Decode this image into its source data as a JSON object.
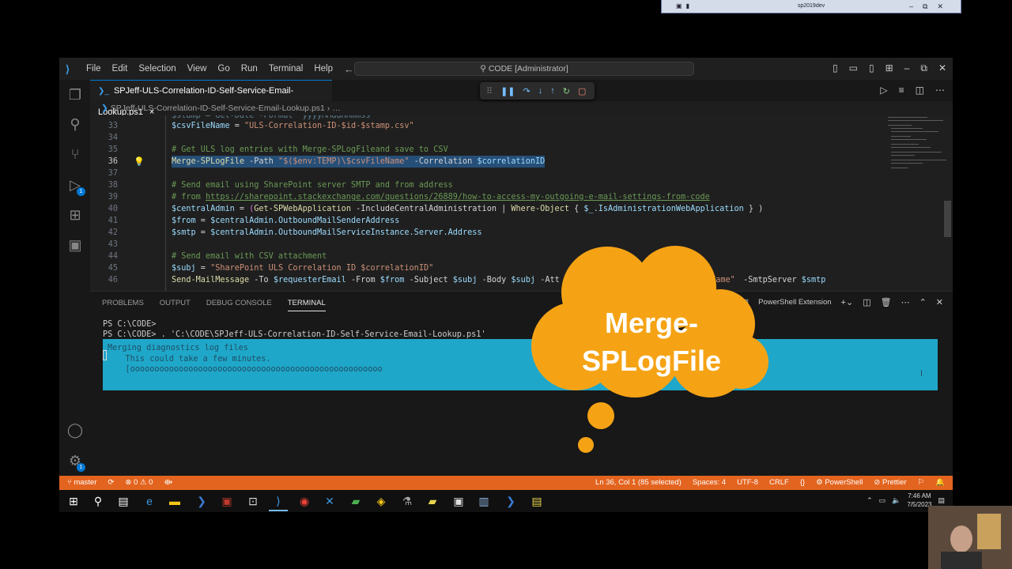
{
  "remote_bar": {
    "title": "sp2019dev"
  },
  "titlebar": {
    "menu": [
      "File",
      "Edit",
      "Selection",
      "View",
      "Go",
      "Run",
      "Terminal",
      "Help"
    ],
    "search": "CODE [Administrator]"
  },
  "tab": {
    "label": "SPJeff-ULS-Correlation-ID-Self-Service-Email-Lookup.ps1",
    "close": "×"
  },
  "breadcrumb": {
    "file": "SPJeff-ULS-Correlation-ID-Self-Service-Email-Lookup.ps1",
    "more": "…"
  },
  "editor": {
    "line_numbers": [
      "33",
      "34",
      "35",
      "36",
      "37",
      "38",
      "39",
      "40",
      "41",
      "42",
      "43",
      "44",
      "45",
      "46"
    ],
    "active_line": "36",
    "lines": {
      "l33_var": "$csvFileName",
      "l33_op": " = ",
      "l33_str": "\"ULS-Correlation-ID-$id-$stamp.csv\"",
      "l35": "# Get ULS log entries with Merge-SPLogFileand save to CSV",
      "l36_fn": "Merge-SPLogFile",
      "l36_p1": " -Path ",
      "l36_str": "\"$($env:TEMP)\\$csvFileName\"",
      "l36_p2": " -Correlation ",
      "l36_var": "$correlationID",
      "l38": "# Send email using SharePoint server SMTP and from address",
      "l39_a": "# from ",
      "l39_link": "https://sharepoint.stackexchange.com/questions/26889/how-to-access-my-outgoing-e-mail-settings-from-code",
      "l40_var": "$centralAdmin",
      "l40_op": " = ",
      "l40_rest_a": "(",
      "l40_fn": "Get-SPWebApplication",
      "l40_rest_b": " -IncludeCentralAdministration | ",
      "l40_fn2": "Where-Object",
      "l40_rest_c": " { ",
      "l40_var2": "$_.IsAdministrationWebApplication",
      "l40_rest_d": " } )",
      "l41_var": "$from",
      "l41_op": " = ",
      "l41_rest": "$centralAdmin.OutboundMailSenderAddress",
      "l42_var": "$smtp",
      "l42_op": " = ",
      "l42_rest": "$centralAdmin.OutboundMailServiceInstance.Server.Address",
      "l44": "# Send email with CSV attachment",
      "l45_var": "$subj",
      "l45_op": " = ",
      "l45_str": "\"SharePoint ULS Correlation ID $correlationID\"",
      "l46_fn": "Send-MailMessage",
      "l46_a": " -To ",
      "l46_v1": "$requesterEmail",
      "l46_b": " -From ",
      "l46_v2": "$from",
      "l46_c": " -Subject ",
      "l46_v3": "$subj",
      "l46_d": " -Body ",
      "l46_v4": "$subj",
      "l46_e": " -Att",
      "l46_str2": "$csvFileName\"",
      "l46_f": " -SmtpServer ",
      "l46_v5": "$smtp"
    }
  },
  "panel": {
    "tabs": [
      "PROBLEMS",
      "OUTPUT",
      "DEBUG CONSOLE",
      "TERMINAL"
    ],
    "active_tab": "TERMINAL",
    "shell": "PowerShell Extension",
    "terminal_lines": [
      "PS C:\\CODE>",
      "PS C:\\CODE> . 'C:\\CODE\\SPJeff-ULS-Correlation-ID-Self-Service-Email-Lookup.ps1'"
    ],
    "progress": {
      "title": "Merging diagnostics log files",
      "subtitle": "    This could take a few minutes.",
      "bar": "    [oooooooooooooooooooooooooooooooooooooooooooooooooooo"
    }
  },
  "statusbar": {
    "branch": "master",
    "problems": "⊗ 0 ⚠ 0",
    "position": "Ln 36, Col 1 (85 selected)",
    "spaces": "Spaces: 4",
    "encoding": "UTF-8",
    "eol": "CRLF",
    "braces": "{}",
    "language": "PowerShell",
    "prettier": "Prettier"
  },
  "taskbar": {
    "time": "7:46 AM",
    "date": "7/5/2023"
  },
  "overlay": {
    "cloud_text": "Merge-\nSPLogFile"
  },
  "badges": {
    "debug": "1",
    "settings": "1"
  },
  "colors": {
    "accent": "#0078d4",
    "status_bar": "#e3641f",
    "cloud": "#f5a315",
    "progress": "#1fa7c9"
  }
}
